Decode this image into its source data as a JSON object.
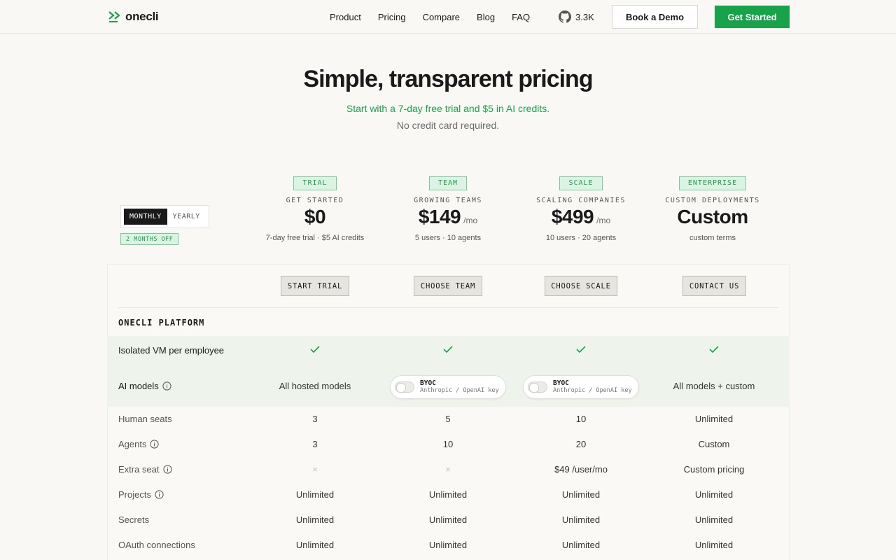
{
  "brand": {
    "name": "onecli",
    "accent": "#16a34a"
  },
  "nav": {
    "links": [
      "Product",
      "Pricing",
      "Compare",
      "Blog",
      "FAQ"
    ],
    "github_stars": "3.3K",
    "demo_label": "Book a Demo",
    "start_label": "Get Started"
  },
  "hero": {
    "title": "Simple, transparent pricing",
    "subtitle": "Start with a 7-day free trial and $5 in AI credits.",
    "subtitle2": "No credit card required."
  },
  "billing": {
    "monthly": "MONTHLY",
    "yearly": "YEARLY",
    "selected": "MONTHLY",
    "discount": "2 MONTHS OFF"
  },
  "plans": [
    {
      "tag": "TRIAL",
      "kicker": "GET STARTED",
      "price": "$0",
      "per": "",
      "note": "7-day free trial · $5 AI credits",
      "cta": "START TRIAL"
    },
    {
      "tag": "TEAM",
      "kicker": "GROWING TEAMS",
      "price": "$149",
      "per": "/mo",
      "note": "5 users · 10 agents",
      "cta": "CHOOSE TEAM"
    },
    {
      "tag": "SCALE",
      "kicker": "SCALING COMPANIES",
      "price": "$499",
      "per": "/mo",
      "note": "10 users · 20 agents",
      "cta": "CHOOSE SCALE"
    },
    {
      "tag": "ENTERPRISE",
      "kicker": "CUSTOM DEPLOYMENTS",
      "price": "Custom",
      "per": "",
      "note": "custom terms",
      "cta": "CONTACT US"
    }
  ],
  "table": {
    "section": "ONECLI PLATFORM",
    "vm_label": "Isolated VM per employee",
    "models_label": "AI models",
    "models": {
      "trial": "All hosted models",
      "byoc_title": "BYOC",
      "byoc_sub": "Anthropic / OpenAI key",
      "enterprise": "All models + custom"
    },
    "rows": [
      {
        "label": "Human seats",
        "values": [
          "3",
          "5",
          "10",
          "Unlimited"
        ]
      },
      {
        "label": "Agents",
        "values": [
          "3",
          "10",
          "20",
          "Custom"
        ]
      },
      {
        "label": "Extra seat",
        "values": [
          "×",
          "×",
          "$49 /user/mo",
          "Custom pricing"
        ]
      },
      {
        "label": "Projects",
        "values": [
          "Unlimited",
          "Unlimited",
          "Unlimited",
          "Unlimited"
        ]
      },
      {
        "label": "Secrets",
        "values": [
          "Unlimited",
          "Unlimited",
          "Unlimited",
          "Unlimited"
        ]
      },
      {
        "label": "OAuth connections",
        "values": [
          "Unlimited",
          "Unlimited",
          "Unlimited",
          "Unlimited"
        ]
      }
    ]
  }
}
